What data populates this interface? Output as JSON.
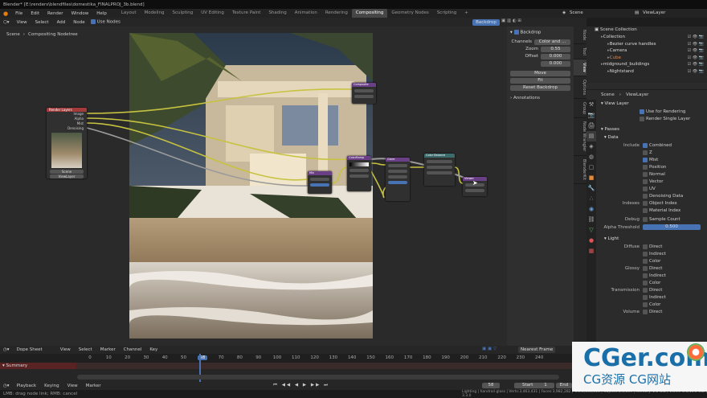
{
  "window_title": "Blender* [E:\\renders\\blendfiles\\domestika_FINALPROJ_3b.blend]",
  "menus": [
    "File",
    "Edit",
    "Render",
    "Window",
    "Help"
  ],
  "workspaces": [
    "Layout",
    "Modeling",
    "Sculpting",
    "UV Editing",
    "Texture Paint",
    "Shading",
    "Animation",
    "Rendering",
    "Compositing",
    "Geometry Nodes",
    "Scripting"
  ],
  "active_workspace": "Compositing",
  "scene_label": "Scene",
  "viewlayer_label": "ViewLayer",
  "node_header": {
    "view": "View",
    "select": "Select",
    "add": "Add",
    "node": "Node",
    "use_nodes": "Use Nodes",
    "backdrop": "Backdrop"
  },
  "breadcrumb": {
    "scene": "Scene",
    "tree": "Compositing Nodetree"
  },
  "nodes": {
    "render_layers": {
      "title": "Render Layers",
      "outputs": [
        "Image",
        "Alpha",
        "Mist",
        "Denoising"
      ],
      "scene": "Scene",
      "layer": "ViewLayer"
    },
    "composite": {
      "title": "Composite"
    },
    "mix": {
      "title": "Mix"
    },
    "color_ramp": {
      "title": "ColorRamp"
    },
    "glare": {
      "title": "Glare"
    },
    "color_balance": {
      "title": "Color Balance"
    },
    "viewer": {
      "title": "Viewer"
    }
  },
  "n_panel": {
    "backdrop": "Backdrop",
    "channels_label": "Channels",
    "channels_value": "Color and ...",
    "zoom_label": "Zoom",
    "zoom_value": "0.55",
    "offset_label": "Offset",
    "offset_x": "0.000",
    "offset_y": "0.000",
    "move": "Move",
    "fit": "Fit",
    "reset": "Reset Backdrop",
    "annotations": "Annotations"
  },
  "side_tabs": [
    "Node",
    "Tool",
    "View",
    "Options",
    "Group",
    "Node Wrangler",
    "BlenderKit"
  ],
  "outliner": {
    "title": "Scene Collection",
    "items": [
      {
        "label": "Collection",
        "indent": 1,
        "color": "#dcdcdc"
      },
      {
        "label": "Bezier curve handles",
        "indent": 2,
        "color": "#dcdcdc"
      },
      {
        "label": "Camera",
        "indent": 2,
        "color": "#dcdcdc"
      },
      {
        "label": "Cube",
        "indent": 2,
        "color": "#e0844a"
      },
      {
        "label": "midground_buildings",
        "indent": 1,
        "color": "#dcdcdc"
      },
      {
        "label": "Nightstand",
        "indent": 2,
        "color": "#dcdcdc"
      }
    ]
  },
  "props": {
    "breadcrumb_scene": "Scene",
    "breadcrumb_layer": "ViewLayer",
    "view_layer": "View Layer",
    "use_for_rendering": "Use for Rendering",
    "render_single": "Render Single Layer",
    "passes": "Passes",
    "data": "Data",
    "include_label": "Include",
    "include": [
      {
        "label": "Combined",
        "on": true
      },
      {
        "label": "Z",
        "on": false
      },
      {
        "label": "Mist",
        "on": true
      },
      {
        "label": "Position",
        "on": false
      },
      {
        "label": "Normal",
        "on": false
      },
      {
        "label": "Vector",
        "on": false
      },
      {
        "label": "UV",
        "on": false
      },
      {
        "label": "Denoising Data",
        "on": false
      }
    ],
    "indexes_label": "Indexes",
    "indexes": [
      "Object Index",
      "Material Index"
    ],
    "debug_label": "Debug",
    "debug": "Sample Count",
    "alpha_label": "Alpha Threshold",
    "alpha_value": "0.500",
    "light": "Light",
    "diffuse_label": "Diffuse",
    "glossy_label": "Glossy",
    "transmission_label": "Transmission",
    "volume_label": "Volume",
    "light_opts": [
      "Direct",
      "Indirect",
      "Color"
    ],
    "volume_opt": "Direct"
  },
  "timeline": {
    "mode": "Dope Sheet",
    "view": "View",
    "select": "Select",
    "marker": "Marker",
    "channel": "Channel",
    "key": "Key",
    "interp": "Nearest Frame",
    "summary": "Summary",
    "ticks": [
      "0",
      "10",
      "20",
      "30",
      "40",
      "50",
      "58",
      "70",
      "80",
      "90",
      "100",
      "110",
      "120",
      "130",
      "140",
      "150",
      "160",
      "170",
      "180",
      "190",
      "200",
      "210",
      "220",
      "230",
      "240"
    ],
    "current_frame": "58",
    "playback": "Playback",
    "keying": "Keying",
    "view2": "View",
    "marker2": "Marker",
    "frame_value": "58",
    "start_label": "Start",
    "start_value": "1",
    "end_label": "End"
  },
  "status": {
    "left": "LMB: drag node link; RMB: cancel",
    "right": "Lighting | handrail glass | Verts:3,463,431 | Faces:3,982,282 | Tris:5,543,515 | Objects:0/1,809 | Memory: 2.2 GiB | VRAM: 5.1/16.0 GiB | 3.3.0"
  },
  "watermark": {
    "main": "CGer.com",
    "sub": "CG资源 CG网站"
  },
  "colors": {
    "accent": "#4772b3",
    "active_tab": "#464646",
    "node_link": "#c7c240",
    "frame_marker": "#4772b3",
    "watermark_blue": "#1a6fa8"
  }
}
